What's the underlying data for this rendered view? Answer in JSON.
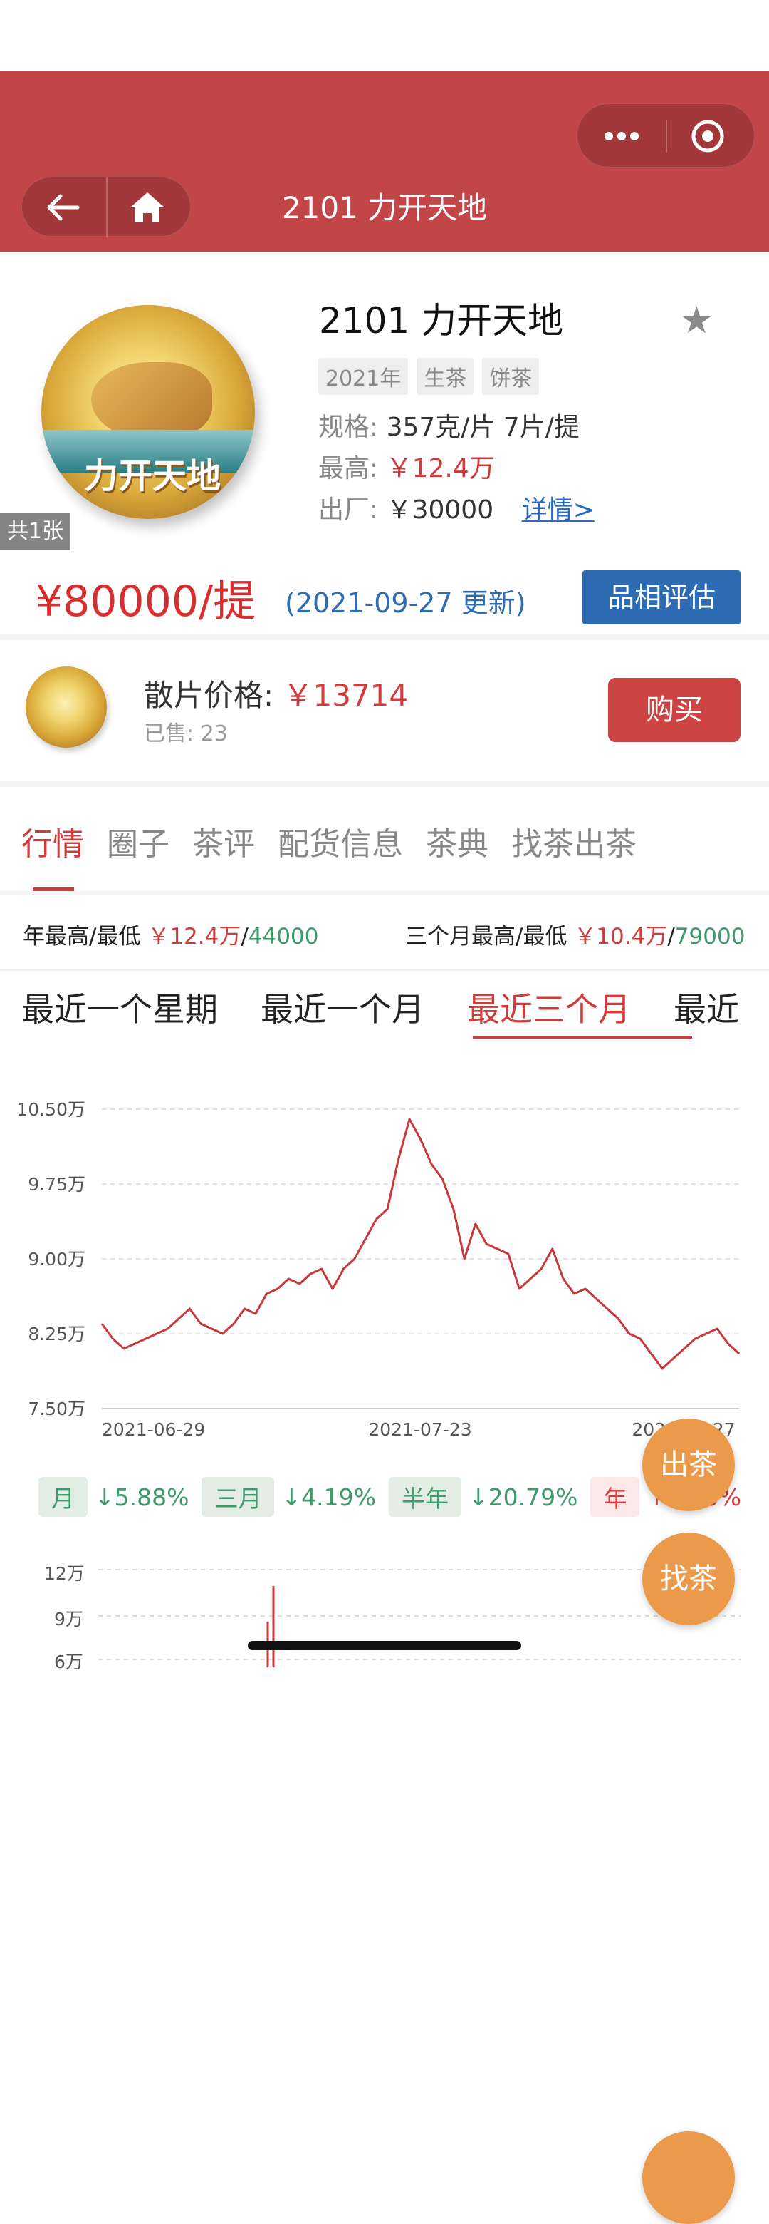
{
  "header": {
    "title": "2101 力开天地"
  },
  "product": {
    "title": "2101 力开天地",
    "image_text": "力开天地",
    "image_count": "共1张",
    "tags": [
      "2021年",
      "生茶",
      "饼茶"
    ],
    "spec_label": "规格:",
    "spec_value": "357克/片 7片/提",
    "high_label": "最高:",
    "high_value": "￥12.4万",
    "factory_label": "出厂:",
    "factory_value": "￥30000",
    "detail_link": "详情>",
    "price": "¥80000/提",
    "price_date": "(2021-09-27 更新)",
    "assess_button": "品相评估"
  },
  "loose": {
    "label": "散片价格:",
    "price": "￥13714",
    "sold": "已售: 23",
    "buy_button": "购买"
  },
  "tabs": [
    "行情",
    "圈子",
    "茶评",
    "配货信息",
    "茶典",
    "找茶出茶"
  ],
  "ranges": {
    "year_label": "年最高/最低",
    "year_high": "￥12.4万",
    "year_sep": "/",
    "year_low": "44000",
    "q_label": "三个月最高/最低",
    "q_high": "￥10.4万",
    "q_sep": "/",
    "q_low": "79000"
  },
  "periods": [
    "最近一个星期",
    "最近一个月",
    "最近三个月",
    "最近"
  ],
  "chart_data": {
    "type": "line",
    "y_ticks": [
      "10.50万",
      "9.75万",
      "9.00万",
      "8.25万",
      "7.50万"
    ],
    "x_ticks": [
      "2021-06-29",
      "2021-07-23",
      "2021-09-27"
    ],
    "ylim": [
      75000,
      105000
    ],
    "series": [
      {
        "values": [
          83500,
          82000,
          81000,
          81500,
          82000,
          82500,
          83000,
          84000,
          85000,
          83500,
          83000,
          82500,
          83500,
          85000,
          84500,
          86500,
          87000,
          88000,
          87500,
          88500,
          89000,
          87000,
          89000,
          90000,
          92000,
          94000,
          95000,
          100000,
          104000,
          102000,
          99500,
          98000,
          95000,
          90000,
          93500,
          91500,
          91000,
          90500,
          87000,
          88000,
          89000,
          91000,
          88000,
          86500,
          87000,
          86000,
          85000,
          84000,
          82500,
          82000,
          80500,
          79000,
          80000,
          81000,
          82000,
          82500,
          83000,
          81500,
          80500
        ]
      }
    ],
    "grid": true,
    "color": "#c8393b"
  },
  "stats": {
    "month_label": "月",
    "month_value": "↓5.88%",
    "q_label": "三月",
    "q_value": "↓4.19%",
    "half_label": "半年",
    "half_value": "↓20.79%",
    "year_label": "年",
    "year_value": "↑0.00%"
  },
  "fab": {
    "sell": "出茶",
    "find": "找茶"
  },
  "volume_axis": [
    "12万",
    "9万",
    "6万"
  ]
}
